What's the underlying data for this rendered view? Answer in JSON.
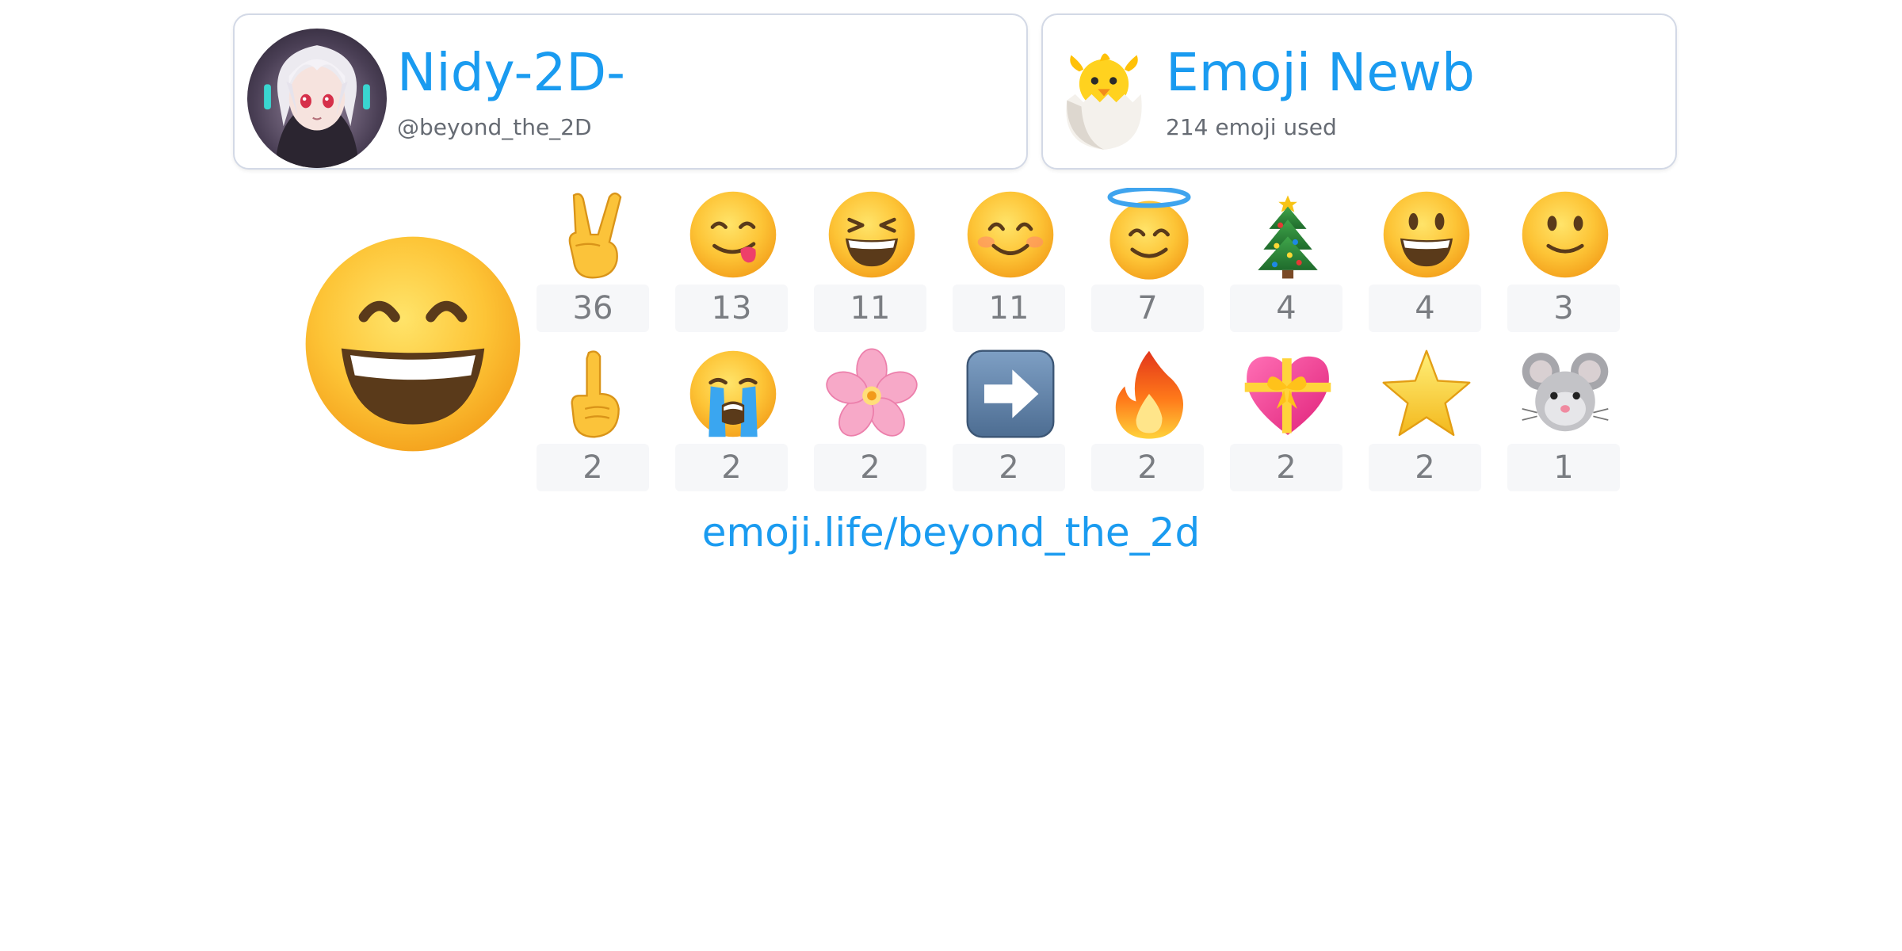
{
  "profile": {
    "display_name": "Nidy-2D-",
    "handle": "@beyond_the_2D"
  },
  "rank": {
    "title": "Emoji Newb",
    "subtitle": "214 emoji used",
    "icon": "hatching-chick-icon"
  },
  "top_emoji": {
    "icon": "grinning-face-with-smiling-eyes-icon"
  },
  "emoji_stats": [
    {
      "emoji": "victory-hand-icon",
      "count": "36"
    },
    {
      "emoji": "face-savoring-food-icon",
      "count": "13"
    },
    {
      "emoji": "squinting-laughing-face-icon",
      "count": "11"
    },
    {
      "emoji": "smiling-face-with-smiling-eyes-icon",
      "count": "11"
    },
    {
      "emoji": "smiling-face-with-halo-icon",
      "count": "7"
    },
    {
      "emoji": "christmas-tree-icon",
      "count": "4"
    },
    {
      "emoji": "grinning-face-big-eyes-icon",
      "count": "4"
    },
    {
      "emoji": "slightly-smiling-face-icon",
      "count": "3"
    },
    {
      "emoji": "index-pointing-up-icon",
      "count": "2"
    },
    {
      "emoji": "loudly-crying-face-icon",
      "count": "2"
    },
    {
      "emoji": "cherry-blossom-icon",
      "count": "2"
    },
    {
      "emoji": "right-arrow-icon",
      "count": "2"
    },
    {
      "emoji": "fire-icon",
      "count": "2"
    },
    {
      "emoji": "heart-with-ribbon-icon",
      "count": "2"
    },
    {
      "emoji": "star-icon",
      "count": "2"
    },
    {
      "emoji": "mouse-face-icon",
      "count": "1"
    }
  ],
  "footer": {
    "link": "emoji.life/beyond_the_2d"
  },
  "colors": {
    "accent": "#1a9bf0",
    "muted_text": "#666b73",
    "count_text": "#7a7d82",
    "count_bg": "#f6f7f9",
    "card_border": "#d3d9e6"
  }
}
